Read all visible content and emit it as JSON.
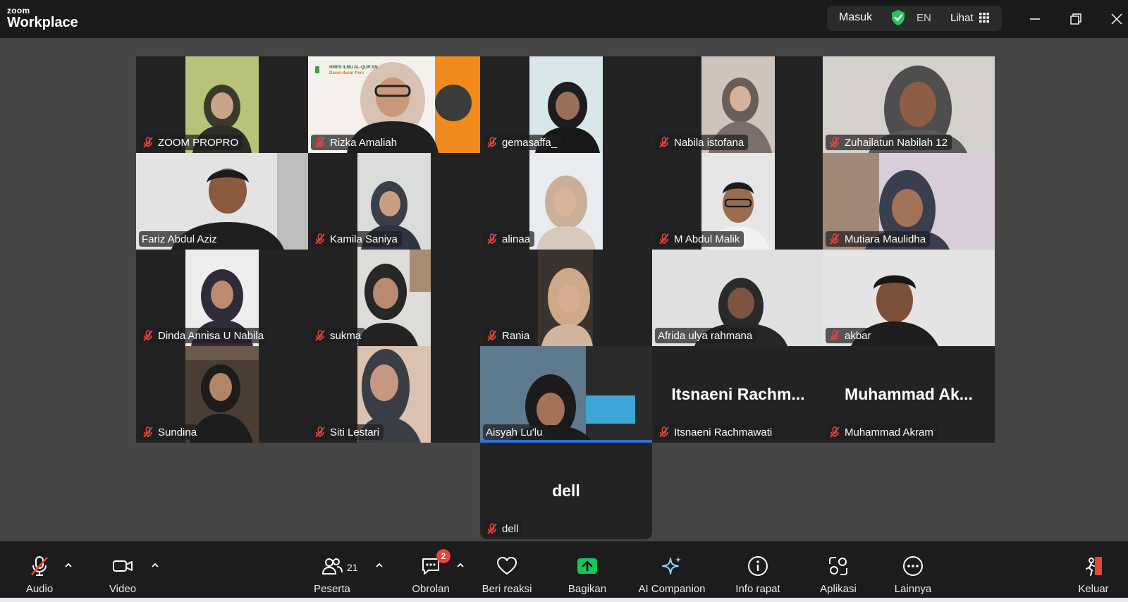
{
  "app": {
    "brand_small": "zoom",
    "brand_large": "Workplace"
  },
  "titlebar": {
    "signin": "Masuk",
    "lang": "EN",
    "view": "Lihat"
  },
  "participants": [
    {
      "name": "ZOOM PROPRO",
      "muted": true
    },
    {
      "name": "Rizka Amaliah",
      "muted": true
    },
    {
      "name": "gemasaffa_",
      "muted": true
    },
    {
      "name": "Nabila istofana",
      "muted": true
    },
    {
      "name": "Zuhailatun Nabilah 12",
      "muted": true
    },
    {
      "name": "Fariz Abdul Aziz",
      "muted": false,
      "active_speaker": true
    },
    {
      "name": "Kamila Saniya",
      "muted": true
    },
    {
      "name": "alinaa",
      "muted": true
    },
    {
      "name": "M Abdul Malik",
      "muted": true
    },
    {
      "name": "Mutiara Maulidha",
      "muted": true
    },
    {
      "name": "Dinda Annisa U Nabila",
      "muted": true
    },
    {
      "name": "sukma",
      "muted": true
    },
    {
      "name": "Rania",
      "muted": true
    },
    {
      "name": "Afrida ulya rahmana",
      "muted": false
    },
    {
      "name": "akbar",
      "muted": true
    },
    {
      "name": "Sundina",
      "muted": true
    },
    {
      "name": "Siti Lestari",
      "muted": true
    },
    {
      "name": "Aisyah Lu'lu",
      "muted": false
    },
    {
      "name": "Itsnaeni Rachmawati",
      "muted": true,
      "video_off_label": "Itsnaeni  Rachm..."
    },
    {
      "name": "Muhammad Akram",
      "muted": true,
      "video_off_label": "Muhammad  Ak..."
    },
    {
      "name": "dell",
      "muted": true,
      "video_off_label": "dell"
    }
  ],
  "slide_text": {
    "line1": "HMPS ILMU AL-QUR'AN",
    "line2": "Dasar-dasar Perc"
  },
  "toolbar": {
    "audio": "Audio",
    "video": "Video",
    "participants": "Peserta",
    "participants_count": "21",
    "chat": "Obrolan",
    "chat_badge": "2",
    "reactions": "Beri reaksi",
    "share": "Bagikan",
    "ai": "AI Companion",
    "info": "Info rapat",
    "apps": "Aplikasi",
    "more": "Lainnya",
    "leave": "Keluar"
  },
  "colors": {
    "active_border": "#22d078",
    "share_green": "#16c45a",
    "mute_red": "#e8453c",
    "leave_red": "#e8453c"
  }
}
